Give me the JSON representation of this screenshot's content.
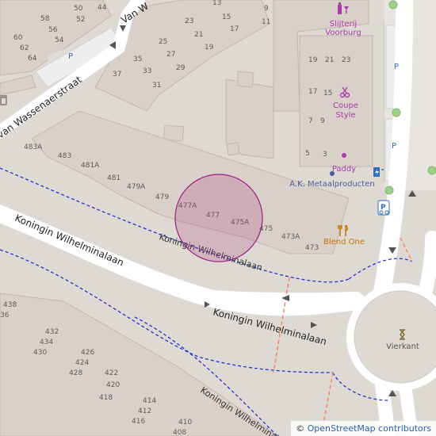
{
  "streets": {
    "koningin_main": "Koningin Wilhelminalaan",
    "koningin_top": "Koningin Wilhelminalaan",
    "koningin_lower": "Koningin Wilhelminalaan",
    "koningin_side": "Koningin Wilhelminalaan",
    "van_wassenaer": "van Wassenaerstraat",
    "van_top": "Van W"
  },
  "house_numbers": {
    "n58": "58",
    "n50": "50",
    "n44": "44",
    "n52": "52",
    "n56": "56",
    "n54": "54",
    "n60": "60",
    "n62": "62",
    "n64": "64",
    "n13": "13",
    "n9": "9",
    "n23a": "23",
    "n15a": "15",
    "n11": "11",
    "n21a": "21",
    "n17a": "17",
    "n25": "25",
    "n19a": "19",
    "n35": "35",
    "n27": "27",
    "n33": "33",
    "n37": "37",
    "n29": "29",
    "n31": "31",
    "n19b": "19",
    "n21b": "21",
    "n23b": "23",
    "n17b": "17",
    "n15b": "15",
    "n7": "7",
    "n9b": "9",
    "n5": "5",
    "n3": "3",
    "n483A": "483A",
    "n483": "483",
    "n481A": "481A",
    "n481": "481",
    "n479A": "479A",
    "n479": "479",
    "n477A": "477A",
    "n477": "477",
    "n475A": "475A",
    "n475": "475",
    "n473A": "473A",
    "n473": "473",
    "n438": "438",
    "n36": "36",
    "n432": "432",
    "n434": "434",
    "n430": "430",
    "n426": "426",
    "n424": "424",
    "n428": "428",
    "n420": "420",
    "n422": "422",
    "n418": "418",
    "n414": "414",
    "n412": "412",
    "n416": "416",
    "n410": "410",
    "n408": "408"
  },
  "pois": {
    "slijterij_line1": "Slijterij",
    "slijterij_line2": "Voorburg",
    "coupe_line1": "Coupe",
    "coupe_line2": "Style",
    "paddy": "Paddy",
    "metaal": "A.K. Metaalproducten",
    "blend_one": "Blend One",
    "vierkant": "Vierkant",
    "parking_p": "P"
  },
  "colors": {
    "background": "#dedad3",
    "building": "#d9d0c9",
    "building_stroke": "#c4b6ab",
    "road": "#ffffff",
    "path_blue": "#2233cc",
    "path_red": "#f28a6b",
    "poi_purple": "#ac39ac",
    "poi_orange": "#c77400",
    "circle_fill": "#a8327a",
    "circle_stroke": "#9b1f84",
    "green_dot": "#9fd089"
  },
  "attribution": {
    "symbol": "©",
    "text": "OpenStreetMap contributors"
  }
}
